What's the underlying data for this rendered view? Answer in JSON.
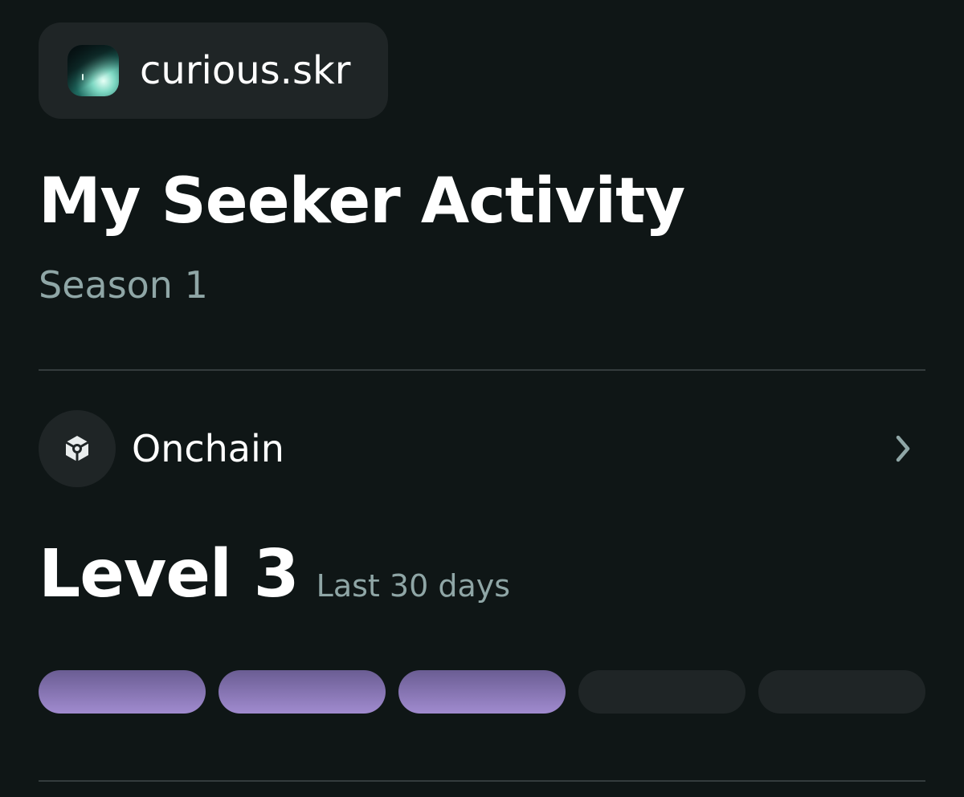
{
  "account": {
    "name": "curious.skr",
    "avatar_icon": "avatar-image"
  },
  "header": {
    "title": "My Seeker Activity",
    "subtitle": "Season 1"
  },
  "category": {
    "label": "Onchain",
    "icon": "cube-icon",
    "chevron_icon": "chevron-right-icon"
  },
  "level": {
    "title": "Level 3",
    "period": "Last 30 days",
    "current": 3,
    "total": 5
  },
  "colors": {
    "background": "#0f1616",
    "surface": "#1f2526",
    "muted_text": "#8fa6a6",
    "accent": "#9685c4"
  }
}
